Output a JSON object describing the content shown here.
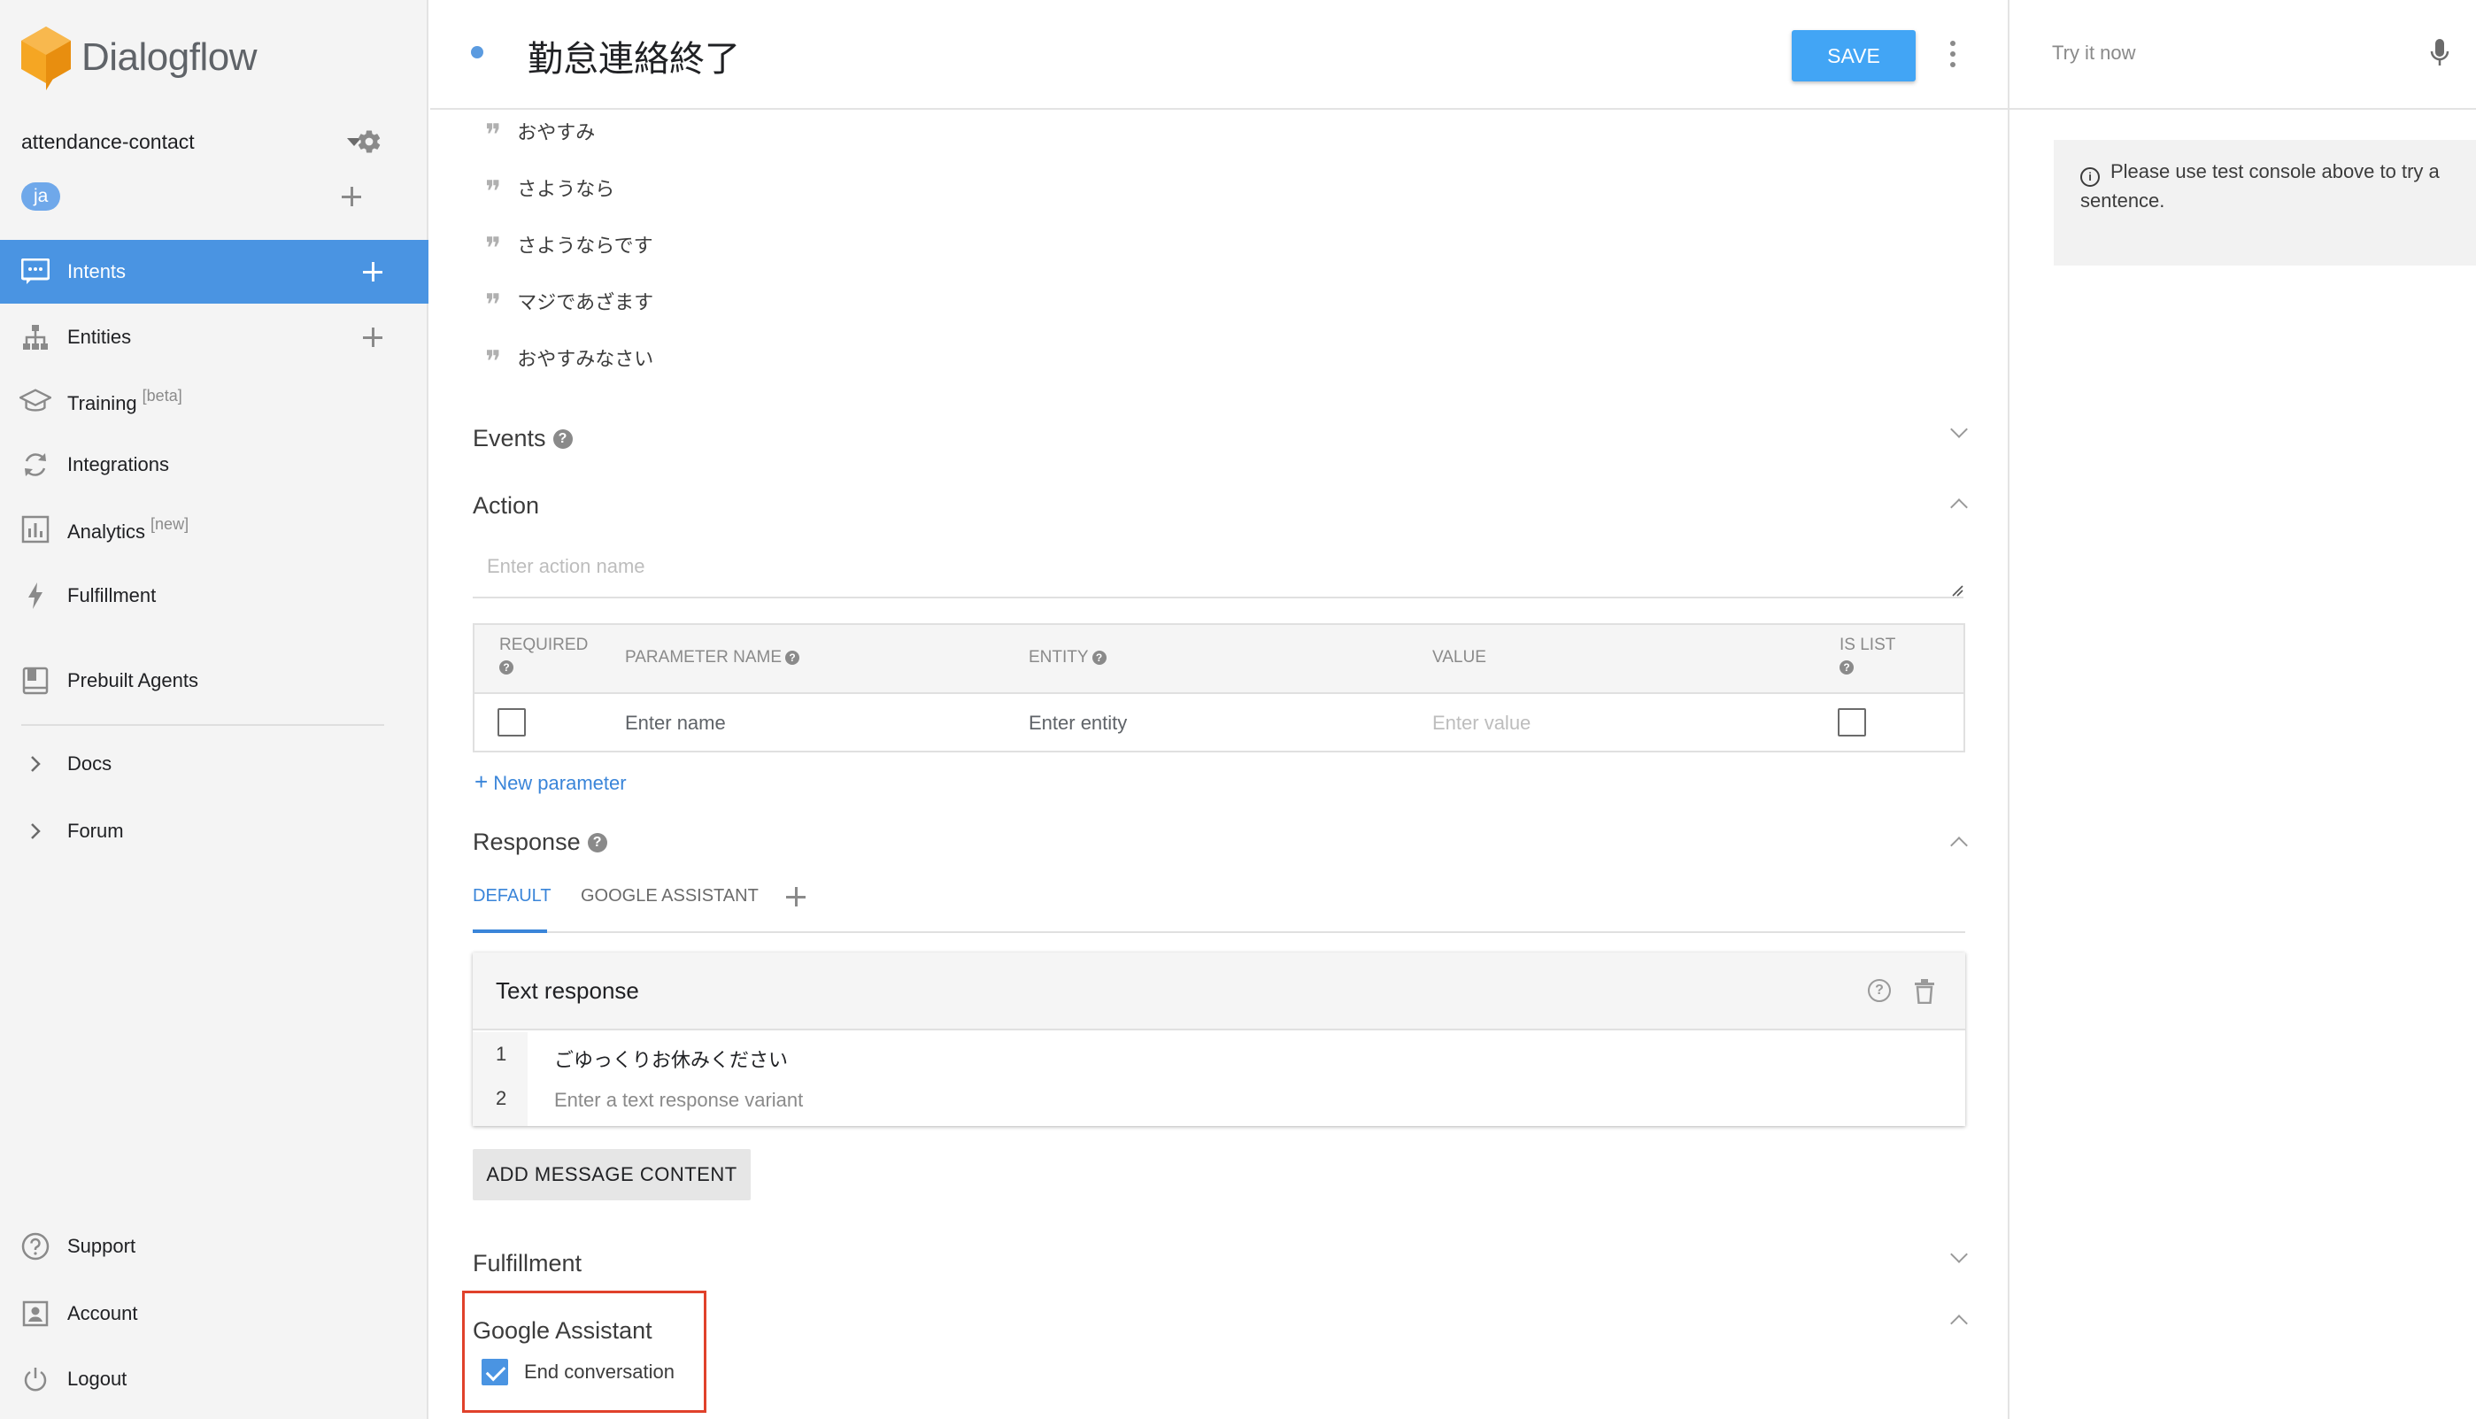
{
  "brand": {
    "name": "Dialogflow",
    "logo_color": "#f5a623"
  },
  "agent": {
    "name": "attendance-contact",
    "language": "ja"
  },
  "nav": {
    "intents": "Intents",
    "entities": "Entities",
    "training": "Training",
    "training_badge": "[beta]",
    "integrations": "Integrations",
    "analytics": "Analytics",
    "analytics_badge": "[new]",
    "fulfillment": "Fulfillment",
    "prebuilt": "Prebuilt Agents",
    "docs": "Docs",
    "forum": "Forum",
    "support": "Support",
    "account": "Account",
    "logout": "Logout"
  },
  "header": {
    "intent_title": "勤怠連絡終了",
    "save_label": "SAVE"
  },
  "training_phrases": [
    "おやすみ",
    "さようなら",
    "さようならです",
    "マジであざます",
    "おやすみなさい"
  ],
  "events": {
    "title": "Events"
  },
  "action": {
    "title": "Action",
    "placeholder": "Enter action name",
    "columns": {
      "required": "REQUIRED",
      "parameter_name": "PARAMETER NAME",
      "entity": "ENTITY",
      "value": "VALUE",
      "is_list": "IS LIST"
    },
    "row": {
      "name_placeholder": "Enter name",
      "entity_placeholder": "Enter entity",
      "value_placeholder": "Enter value"
    },
    "new_parameter": "New parameter"
  },
  "response": {
    "title": "Response",
    "tabs": [
      "DEFAULT",
      "GOOGLE ASSISTANT"
    ],
    "text_response": {
      "title": "Text response",
      "lines": [
        {
          "num": "1",
          "text": "ごゆっくりお休みください"
        },
        {
          "num": "2",
          "placeholder": "Enter a text response variant"
        }
      ]
    },
    "add_message_content": "ADD MESSAGE CONTENT"
  },
  "fulfillment": {
    "title": "Fulfillment"
  },
  "google_assistant": {
    "title": "Google Assistant",
    "end_conversation": "End conversation",
    "end_conversation_checked": true
  },
  "console": {
    "placeholder": "Try it now",
    "info": "Please use test console above to try a sentence."
  },
  "colors": {
    "accent": "#4a94e2",
    "save": "#42a5f5",
    "highlight": "#e0412b"
  }
}
